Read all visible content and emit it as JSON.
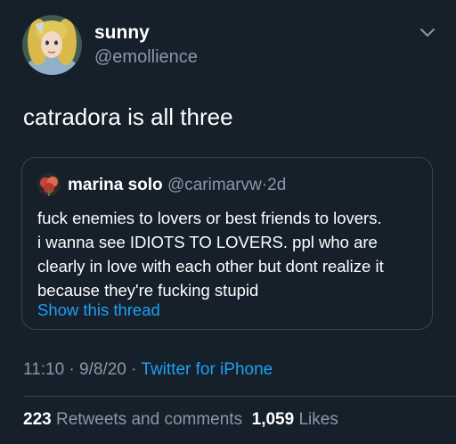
{
  "tweet": {
    "author": {
      "name": "sunny",
      "handle": "@emollience"
    },
    "text": "catradora is all three",
    "quote": {
      "name": "marina solo",
      "handle": "@carimarvw",
      "dot": "·",
      "time": "2d",
      "lines": [
        "fuck enemies to lovers or best friends to lovers.",
        "i wanna see IDIOTS TO LOVERS. ppl who are",
        "clearly in love with each other but dont realize it",
        "because they're fucking stupid"
      ],
      "show_thread": "Show this thread"
    },
    "meta": {
      "time": "11:10",
      "sep1": "·",
      "date": "9/8/20",
      "sep2": "·",
      "source": "Twitter for iPhone"
    },
    "stats": {
      "retweets_count": "223",
      "retweets_label": "Retweets and comments",
      "likes_count": "1,059",
      "likes_label": "Likes"
    }
  },
  "colors": {
    "background": "#15202b",
    "text_primary": "#ffffff",
    "text_secondary": "#8899a6",
    "accent": "#1da1f2",
    "border": "#38444d"
  },
  "icons": {
    "caret": "chevron-down-icon"
  }
}
